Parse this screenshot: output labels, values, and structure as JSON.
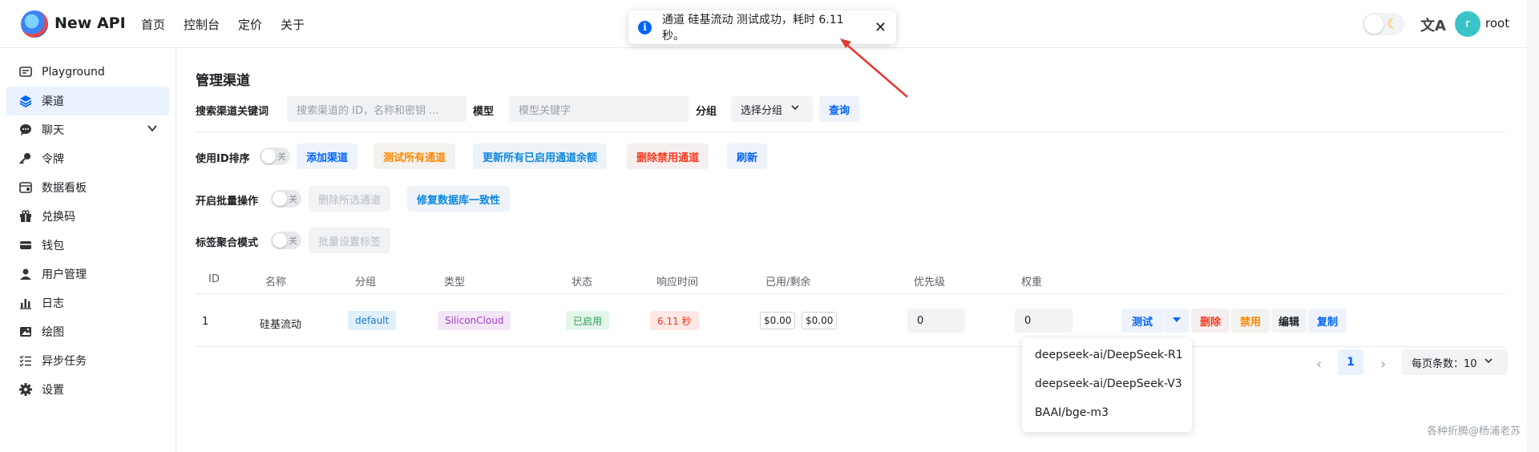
{
  "header": {
    "brand": "New API",
    "nav": [
      "首页",
      "控制台",
      "定价",
      "关于"
    ],
    "username": "root",
    "avatar_letter": "r"
  },
  "toast": {
    "message": "通道 硅基流动 测试成功，耗时 6.11 秒。",
    "close": "✕"
  },
  "sidebar": {
    "items": [
      {
        "label": "Playground",
        "icon": "chat-box-icon"
      },
      {
        "label": "渠道",
        "icon": "layers-icon",
        "active": true
      },
      {
        "label": "聊天",
        "icon": "chat-bubble-icon",
        "expandable": true
      },
      {
        "label": "令牌",
        "icon": "key-icon"
      },
      {
        "label": "数据看板",
        "icon": "dashboard-icon"
      },
      {
        "label": "兑换码",
        "icon": "gift-icon"
      },
      {
        "label": "钱包",
        "icon": "credit-card-icon"
      },
      {
        "label": "用户管理",
        "icon": "user-icon"
      },
      {
        "label": "日志",
        "icon": "bar-chart-icon"
      },
      {
        "label": "绘图",
        "icon": "image-icon"
      },
      {
        "label": "异步任务",
        "icon": "task-list-icon"
      },
      {
        "label": "设置",
        "icon": "gear-icon"
      }
    ]
  },
  "main": {
    "title": "管理渠道",
    "search": {
      "keyword_label": "搜索渠道关键词",
      "keyword_placeholder": "搜索渠道的 ID，名称和密钥 ...",
      "model_label": "模型",
      "model_placeholder": "模型关键字",
      "group_label": "分组",
      "group_select": "选择分组",
      "query_button": "查询"
    },
    "row1": {
      "sort_label": "使用ID排序",
      "switch_text": "关",
      "add": "添加渠道",
      "test_all": "测试所有通道",
      "update_balance": "更新所有已启用通道余额",
      "delete_disabled": "删除禁用通道",
      "refresh": "刷新"
    },
    "row2": {
      "batch_label": "开启批量操作",
      "switch_text": "关",
      "delete_selected": "删除所选通道",
      "fix_db": "修复数据库一致性"
    },
    "row3": {
      "tag_label": "标签聚合模式",
      "switch_text": "关",
      "batch_tag": "批量设置标签"
    },
    "table": {
      "headers": [
        "ID",
        "名称",
        "分组",
        "类型",
        "状态",
        "响应时间",
        "已用/剩余",
        "优先级",
        "权重"
      ],
      "rows": [
        {
          "id": "1",
          "name": "硅基流动",
          "group": "default",
          "type": "SiliconCloud",
          "status": "已启用",
          "response": "6.11 秒",
          "used": "$0.00",
          "remaining": "$0.00",
          "priority": "0",
          "weight": "0"
        }
      ],
      "actions": {
        "test": "测试",
        "delete": "删除",
        "disable": "禁用",
        "edit": "编辑",
        "copy": "复制"
      }
    },
    "dropdown": [
      "deepseek-ai/DeepSeek-R1",
      "deepseek-ai/DeepSeek-V3",
      "BAAI/bge-m3"
    ],
    "pagination": {
      "current": "1",
      "page_size": "每页条数：10"
    }
  },
  "watermark": "各种折腾@杨浦老苏",
  "colors": {
    "primary": "#0064fa",
    "orange": "#fc8800",
    "red": "#f93920",
    "arrow": "#e53935"
  }
}
